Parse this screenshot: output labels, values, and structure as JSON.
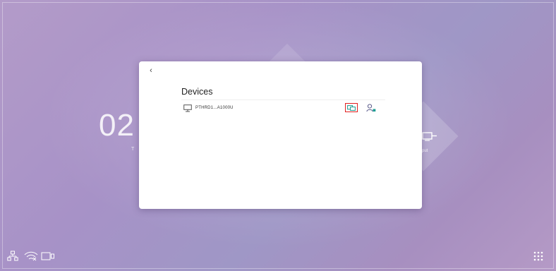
{
  "background": {
    "clock_text": "02",
    "clock_sub": "T",
    "input_label": "put"
  },
  "dialog": {
    "back_label": "‹",
    "title": "Devices",
    "devices": [
      {
        "name": "PTHRD1...A1000U",
        "icon": "monitor-icon",
        "actions": [
          "cast-icon",
          "user-settings-icon"
        ]
      }
    ]
  },
  "statusbar": {
    "icons": [
      "network-icon",
      "wifi-off-icon",
      "screen-share-icon"
    ],
    "apps_icon": "apps-grid-icon"
  },
  "colors": {
    "accent": "#1a9c92",
    "highlight_border": "#e02020"
  }
}
